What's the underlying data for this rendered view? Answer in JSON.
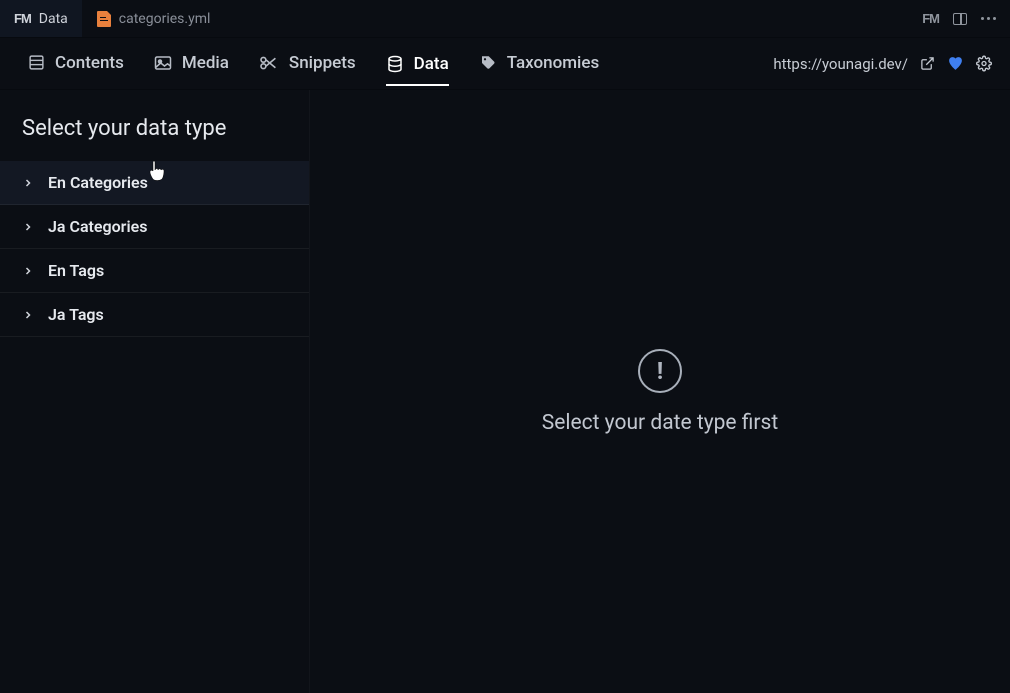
{
  "titlebar": {
    "tabs": [
      {
        "type": "data",
        "label": "Data",
        "active": true,
        "icon": "fm-logo-icon"
      },
      {
        "type": "file",
        "label": "categories.yml",
        "active": false,
        "icon": "yaml-file-icon"
      }
    ],
    "actions": {
      "fm_icon": "FM",
      "split_icon": "split-view-icon",
      "more_icon": "more-icon"
    }
  },
  "navbar": {
    "items": [
      {
        "label": "Contents",
        "icon": "contents-icon",
        "active": false
      },
      {
        "label": "Media",
        "icon": "media-icon",
        "active": false
      },
      {
        "label": "Snippets",
        "icon": "snippets-icon",
        "active": false
      },
      {
        "label": "Data",
        "icon": "data-icon",
        "active": true
      },
      {
        "label": "Taxonomies",
        "icon": "taxonomies-icon",
        "active": false
      }
    ],
    "right": {
      "url": "https://younagi.dev/",
      "open_icon": "external-link-icon",
      "heart_icon": "heart-icon",
      "settings_icon": "gear-icon"
    }
  },
  "sidebar": {
    "title": "Select your data type",
    "items": [
      {
        "label": "En Categories",
        "hovered": true
      },
      {
        "label": "Ja Categories",
        "hovered": false
      },
      {
        "label": "En Tags",
        "hovered": false
      },
      {
        "label": "Ja Tags",
        "hovered": false
      }
    ]
  },
  "main": {
    "empty_icon": "alert-circle-icon",
    "empty_text": "Select your date type first"
  }
}
